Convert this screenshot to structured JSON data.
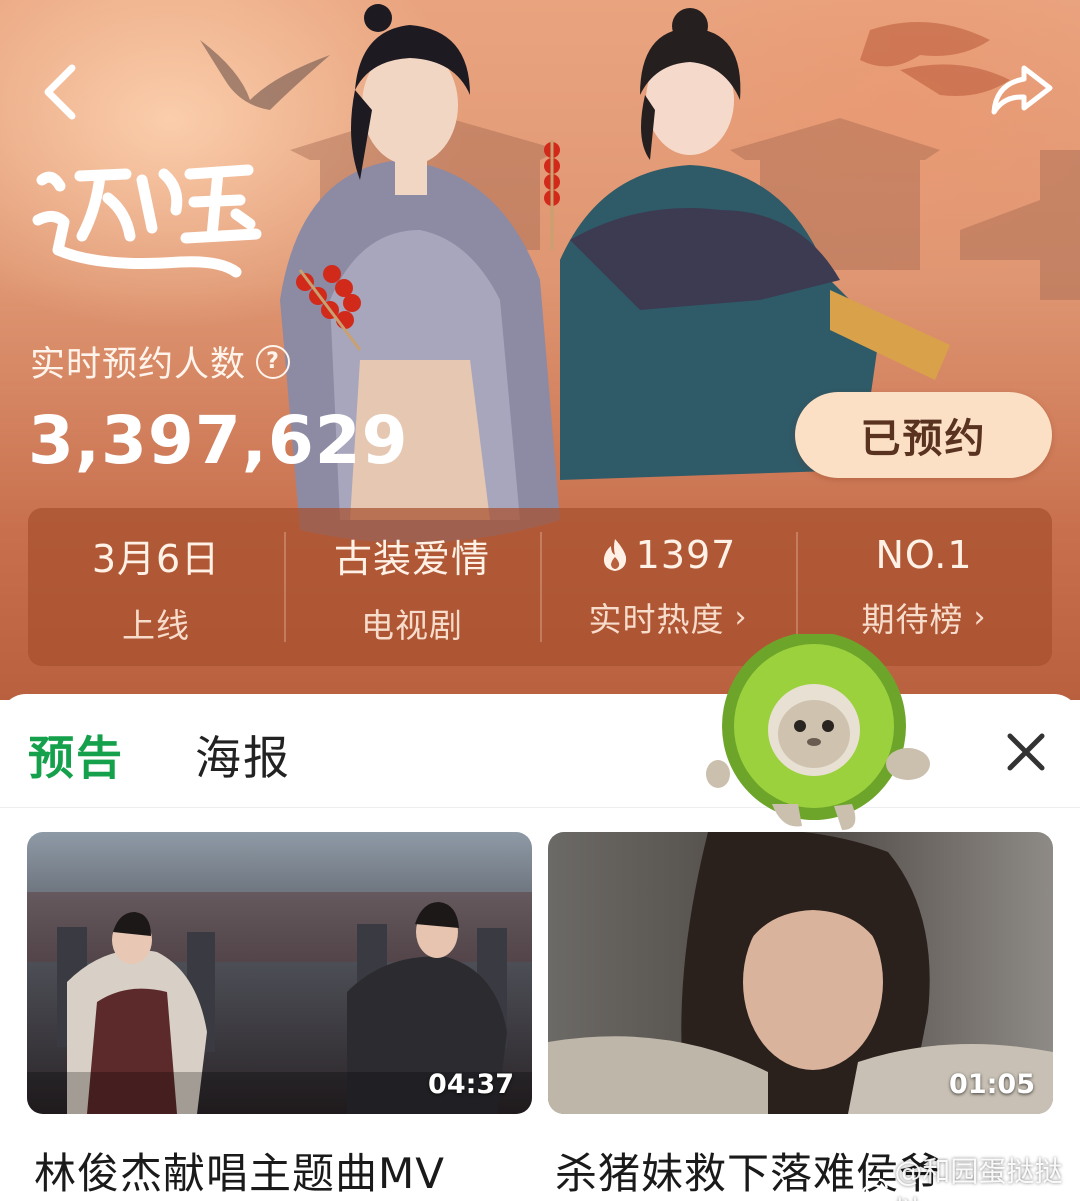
{
  "hero": {
    "show_title_art": "逐玉",
    "reservation_label": "实时预约人数",
    "help_icon": "question-circle-icon",
    "reservation_count": "3,397,629",
    "reserved_button": "已预约",
    "stats": [
      {
        "value": "3月6日",
        "label": "上线",
        "icon": "",
        "has_chevron": false
      },
      {
        "value": "古装爱情",
        "label": "电视剧",
        "icon": "",
        "has_chevron": false
      },
      {
        "value": "1397",
        "label": "实时热度",
        "icon": "flame-icon",
        "has_chevron": true
      },
      {
        "value": "NO.1",
        "label": "期待榜",
        "icon": "",
        "has_chevron": true
      }
    ],
    "chevron": "›"
  },
  "tabs": {
    "trailer": "预告",
    "poster": "海报",
    "active": "预告"
  },
  "videos": [
    {
      "duration": "04:37",
      "title": "林俊杰献唱主题曲MV"
    },
    {
      "duration": "01:05",
      "title": "杀猪妹救下落难侯爷"
    }
  ],
  "watermark": "@和园蛋挞挞挞",
  "colors": {
    "accent_green": "#15a14b",
    "hero_orange": "#df9672",
    "reserved_button_bg": "#fbe0c6"
  }
}
